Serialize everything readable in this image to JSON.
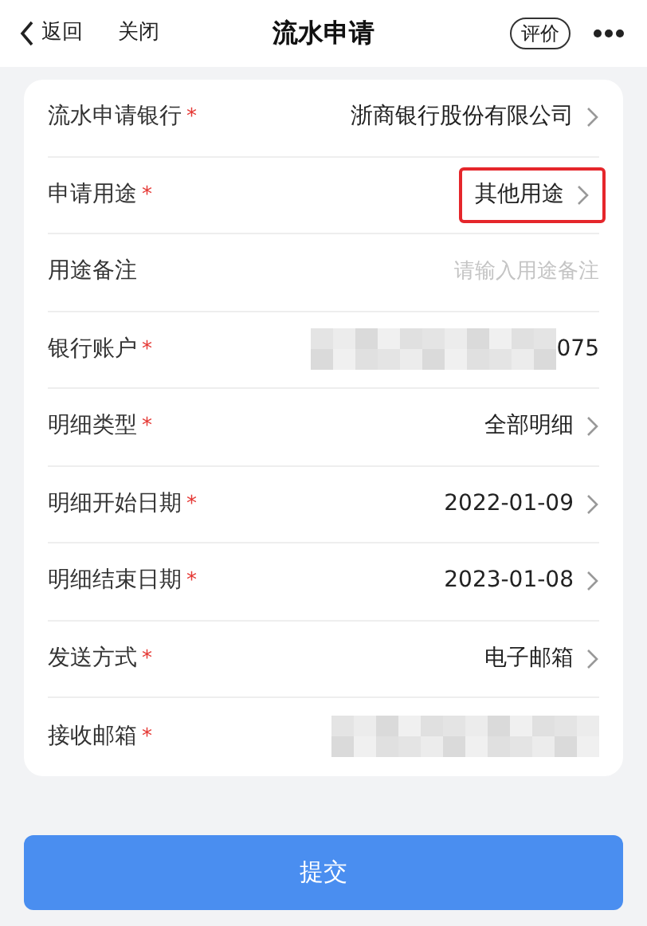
{
  "nav_bar": {
    "back_label": "返回",
    "close_label": "关闭",
    "title": "流水申请",
    "rate_label": "评价"
  },
  "form_rows": [
    {
      "label": "流水申请银行",
      "required_mark": "*",
      "kind": "select",
      "value": "浙商银行股份有限公司",
      "highlighted": false
    },
    {
      "label": "申请用途",
      "required_mark": "*",
      "kind": "select",
      "value": "其他用途",
      "highlighted": true
    },
    {
      "label": "用途备注",
      "kind": "input",
      "placeholder": "请输入用途备注",
      "highlighted": false
    },
    {
      "label": "银行账户",
      "required_mark": "*",
      "kind": "masked",
      "visible_suffix": "075",
      "highlighted": false
    },
    {
      "label": "明细类型",
      "required_mark": "*",
      "kind": "select",
      "value": "全部明细",
      "highlighted": false
    },
    {
      "label": "明细开始日期",
      "required_mark": "*",
      "kind": "select",
      "value": "2022-01-09",
      "highlighted": false
    },
    {
      "label": "明细结束日期",
      "required_mark": "*",
      "kind": "select",
      "value": "2023-01-08",
      "highlighted": false
    },
    {
      "label": "发送方式",
      "required_mark": "*",
      "kind": "select",
      "value": "电子邮箱",
      "highlighted": false
    },
    {
      "label": "接收邮箱",
      "required_mark": "*",
      "kind": "masked",
      "highlighted": false
    }
  ],
  "submit_button": "提交"
}
